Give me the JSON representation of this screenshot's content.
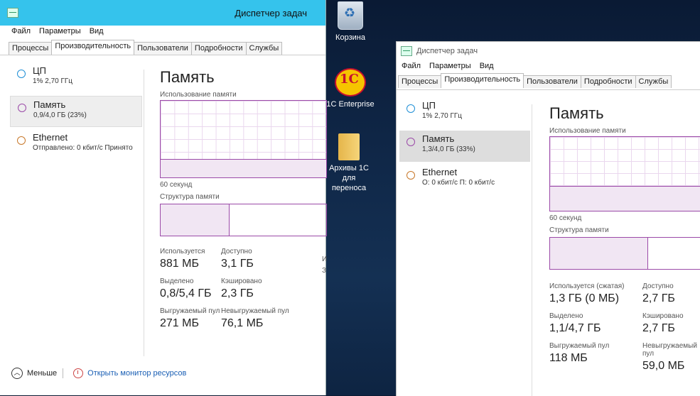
{
  "desktop": {
    "icons": [
      {
        "label": "Корзина"
      },
      {
        "label": "1C Enterprise"
      },
      {
        "label": "Архивы 1С для переноса"
      }
    ]
  },
  "window1": {
    "title": "Диспетчер задач",
    "menu": [
      "Файл",
      "Параметры",
      "Вид"
    ],
    "tabs": [
      "Процессы",
      "Производительность",
      "Пользователи",
      "Подробности",
      "Службы"
    ],
    "resources": [
      {
        "name": "ЦП",
        "detail": "1% 2,70 ГГц",
        "color": "#1f8fd6"
      },
      {
        "name": "Память",
        "detail": "0,9/4,0 ГБ (23%)",
        "color": "#9b4aa8"
      },
      {
        "name": "Ethernet",
        "detail": "Отправлено: 0 кбит/с  Принято",
        "color": "#c8782a"
      }
    ],
    "main": {
      "title": "Память",
      "usage_label": "Использование памяти",
      "usage_fraction": 0.23,
      "time_label": "60 секунд",
      "structure_label": "Структура памяти",
      "stats": [
        {
          "key": "Используется",
          "value": "881 МБ"
        },
        {
          "key": "Доступно",
          "value": "3,1 ГБ"
        },
        {
          "key": "Выделено",
          "value": "0,8/5,4 ГБ"
        },
        {
          "key": "Кэшировано",
          "value": "2,3 ГБ"
        },
        {
          "key": "Выгружаемый пул",
          "value": "271 МБ"
        },
        {
          "key": "Невыгружаемый пул",
          "value": "76,1 МБ"
        }
      ],
      "edge_cut_1": "И",
      "edge_cut_2": "З"
    },
    "footer": {
      "less": "Меньше",
      "monitor": "Открыть монитор ресурсов"
    }
  },
  "window2": {
    "title": "Диспетчер задач",
    "menu": [
      "Файл",
      "Параметры",
      "Вид"
    ],
    "tabs": [
      "Процессы",
      "Производительность",
      "Пользователи",
      "Подробности",
      "Службы"
    ],
    "resources": [
      {
        "name": "ЦП",
        "detail": "1% 2,70 ГГц",
        "color": "#1f8fd6"
      },
      {
        "name": "Память",
        "detail": "1,3/4,0 ГБ (33%)",
        "color": "#9b4aa8"
      },
      {
        "name": "Ethernet",
        "detail": "О: 0 кбит/с П: 0 кбит/с",
        "color": "#c8782a"
      }
    ],
    "main": {
      "title": "Память",
      "usage_label": "Использование памяти",
      "usage_fraction": 0.33,
      "time_label": "60 секунд",
      "structure_label": "Структура памяти",
      "stats": [
        {
          "key": "Используется (сжатая)",
          "value": "1,3 ГБ (0 МБ)"
        },
        {
          "key": "Доступно",
          "value": "2,7 ГБ"
        },
        {
          "key": "Выделено",
          "value": "1,1/4,7 ГБ"
        },
        {
          "key": "Кэшировано",
          "value": "2,7 ГБ"
        },
        {
          "key": "Выгружаемый пул",
          "value": "118 МБ"
        },
        {
          "key": "Невыгружаемый пул",
          "value": "59,0 МБ"
        }
      ]
    }
  }
}
